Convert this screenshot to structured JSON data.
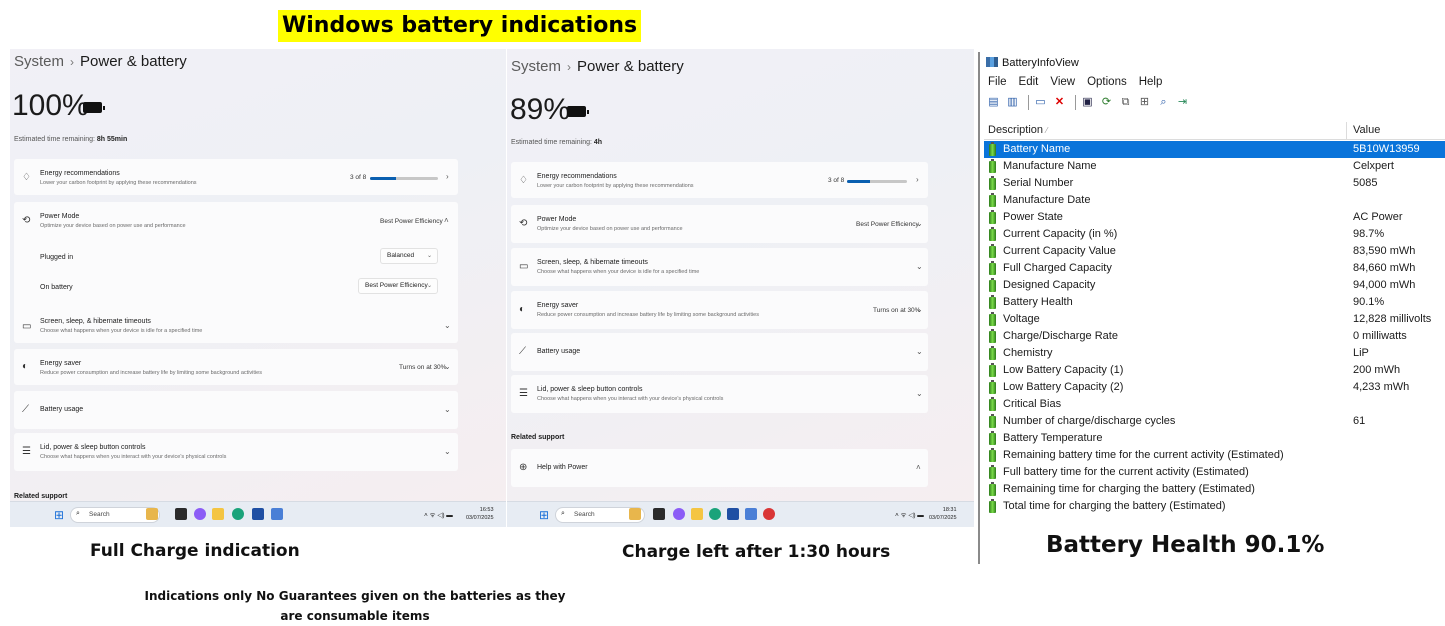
{
  "headline": "Windows battery indications",
  "left_panel": {
    "breadcrumb_parent": "System",
    "breadcrumb_current": "Power & battery",
    "percent": "100%",
    "estimated_label": "Estimated time remaining:",
    "estimated_value": "8h 55min",
    "energy_recommendations": {
      "title": "Energy recommendations",
      "subtitle": "Lower your carbon footprint by applying these recommendations",
      "progress_text": "3 of 8",
      "progress_fraction": 0.375
    },
    "power_mode": {
      "title": "Power Mode",
      "subtitle": "Optimize your device based on power use and performance",
      "value": "Best Power Efficiency"
    },
    "plugged_in": {
      "label": "Plugged in",
      "value": "Balanced"
    },
    "on_battery": {
      "label": "On battery",
      "value": "Best Power Efficiency"
    },
    "screen_sleep": {
      "title": "Screen, sleep, & hibernate timeouts",
      "subtitle": "Choose what happens when your device is idle for a specified time"
    },
    "energy_saver": {
      "title": "Energy saver",
      "subtitle": "Reduce power consumption and increase battery life by limiting some background activities",
      "value": "Turns on at 30%"
    },
    "battery_usage": {
      "title": "Battery usage"
    },
    "lid_power": {
      "title": "Lid, power & sleep button controls",
      "subtitle": "Choose what happens when you interact with your device's physical controls"
    },
    "related_support": "Related support",
    "taskbar": {
      "search": "Search",
      "time": "16:53",
      "date": "03/07/2025"
    }
  },
  "middle_panel": {
    "breadcrumb_parent": "System",
    "breadcrumb_current": "Power & battery",
    "percent": "89%",
    "estimated_label": "Estimated time remaining:",
    "estimated_value": "4h",
    "energy_recommendations": {
      "title": "Energy recommendations",
      "subtitle": "Lower your carbon footprint by applying these recommendations",
      "progress_text": "3 of 8",
      "progress_fraction": 0.375
    },
    "power_mode": {
      "title": "Power Mode",
      "subtitle": "Optimize your device based on power use and performance",
      "value": "Best Power Efficiency"
    },
    "screen_sleep": {
      "title": "Screen, sleep, & hibernate timeouts",
      "subtitle": "Choose what happens when your device is idle for a specified time"
    },
    "energy_saver": {
      "title": "Energy saver",
      "subtitle": "Reduce power consumption and increase battery life by limiting some background activities",
      "value": "Turns on at 30%"
    },
    "battery_usage": {
      "title": "Battery usage"
    },
    "lid_power": {
      "title": "Lid, power & sleep button controls",
      "subtitle": "Choose what happens when you interact with your device's physical controls"
    },
    "related_support": "Related support",
    "help_with_power": "Help with Power",
    "taskbar": {
      "search": "Search",
      "time": "18:31",
      "date": "03/07/2025"
    }
  },
  "battery_info_view": {
    "title": "BatteryInfoView",
    "menu": [
      "File",
      "Edit",
      "View",
      "Options",
      "Help"
    ],
    "col_description": "Description",
    "col_value": "Value",
    "rows": [
      {
        "d": "Battery Name",
        "v": "5B10W13959"
      },
      {
        "d": "Manufacture Name",
        "v": "Celxpert"
      },
      {
        "d": "Serial Number",
        "v": " 5085"
      },
      {
        "d": "Manufacture Date",
        "v": ""
      },
      {
        "d": "Power State",
        "v": "AC Power"
      },
      {
        "d": "Current Capacity (in %)",
        "v": "98.7%"
      },
      {
        "d": "Current Capacity Value",
        "v": "83,590 mWh"
      },
      {
        "d": "Full Charged Capacity",
        "v": "84,660 mWh"
      },
      {
        "d": "Designed Capacity",
        "v": "94,000 mWh"
      },
      {
        "d": "Battery Health",
        "v": "90.1%"
      },
      {
        "d": "Voltage",
        "v": "12,828 millivolts"
      },
      {
        "d": "Charge/Discharge Rate",
        "v": "0 milliwatts"
      },
      {
        "d": "Chemistry",
        "v": "LiP"
      },
      {
        "d": "Low Battery Capacity (1)",
        "v": "200 mWh"
      },
      {
        "d": "Low Battery Capacity (2)",
        "v": "4,233 mWh"
      },
      {
        "d": "Critical Bias",
        "v": ""
      },
      {
        "d": "Number of charge/discharge cycles",
        "v": "61"
      },
      {
        "d": "Battery Temperature",
        "v": ""
      },
      {
        "d": "Remaining battery time for the current activity (Estimated)",
        "v": ""
      },
      {
        "d": "Full battery time for the current activity (Estimated)",
        "v": ""
      },
      {
        "d": "Remaining time for charging the battery (Estimated)",
        "v": ""
      },
      {
        "d": "Total  time for charging the battery (Estimated)",
        "v": ""
      }
    ]
  },
  "captions": {
    "full_charge": "Full Charge indication",
    "charge_left": "Charge left after 1:30 hours",
    "battery_health": "Battery Health 90.1%",
    "note": "Indications only No Guarantees given on the batteries as they are consumable items"
  },
  "colors": {
    "highlight": "#ffff00",
    "selection": "#0a74da",
    "progress": "#0a5fb0"
  }
}
